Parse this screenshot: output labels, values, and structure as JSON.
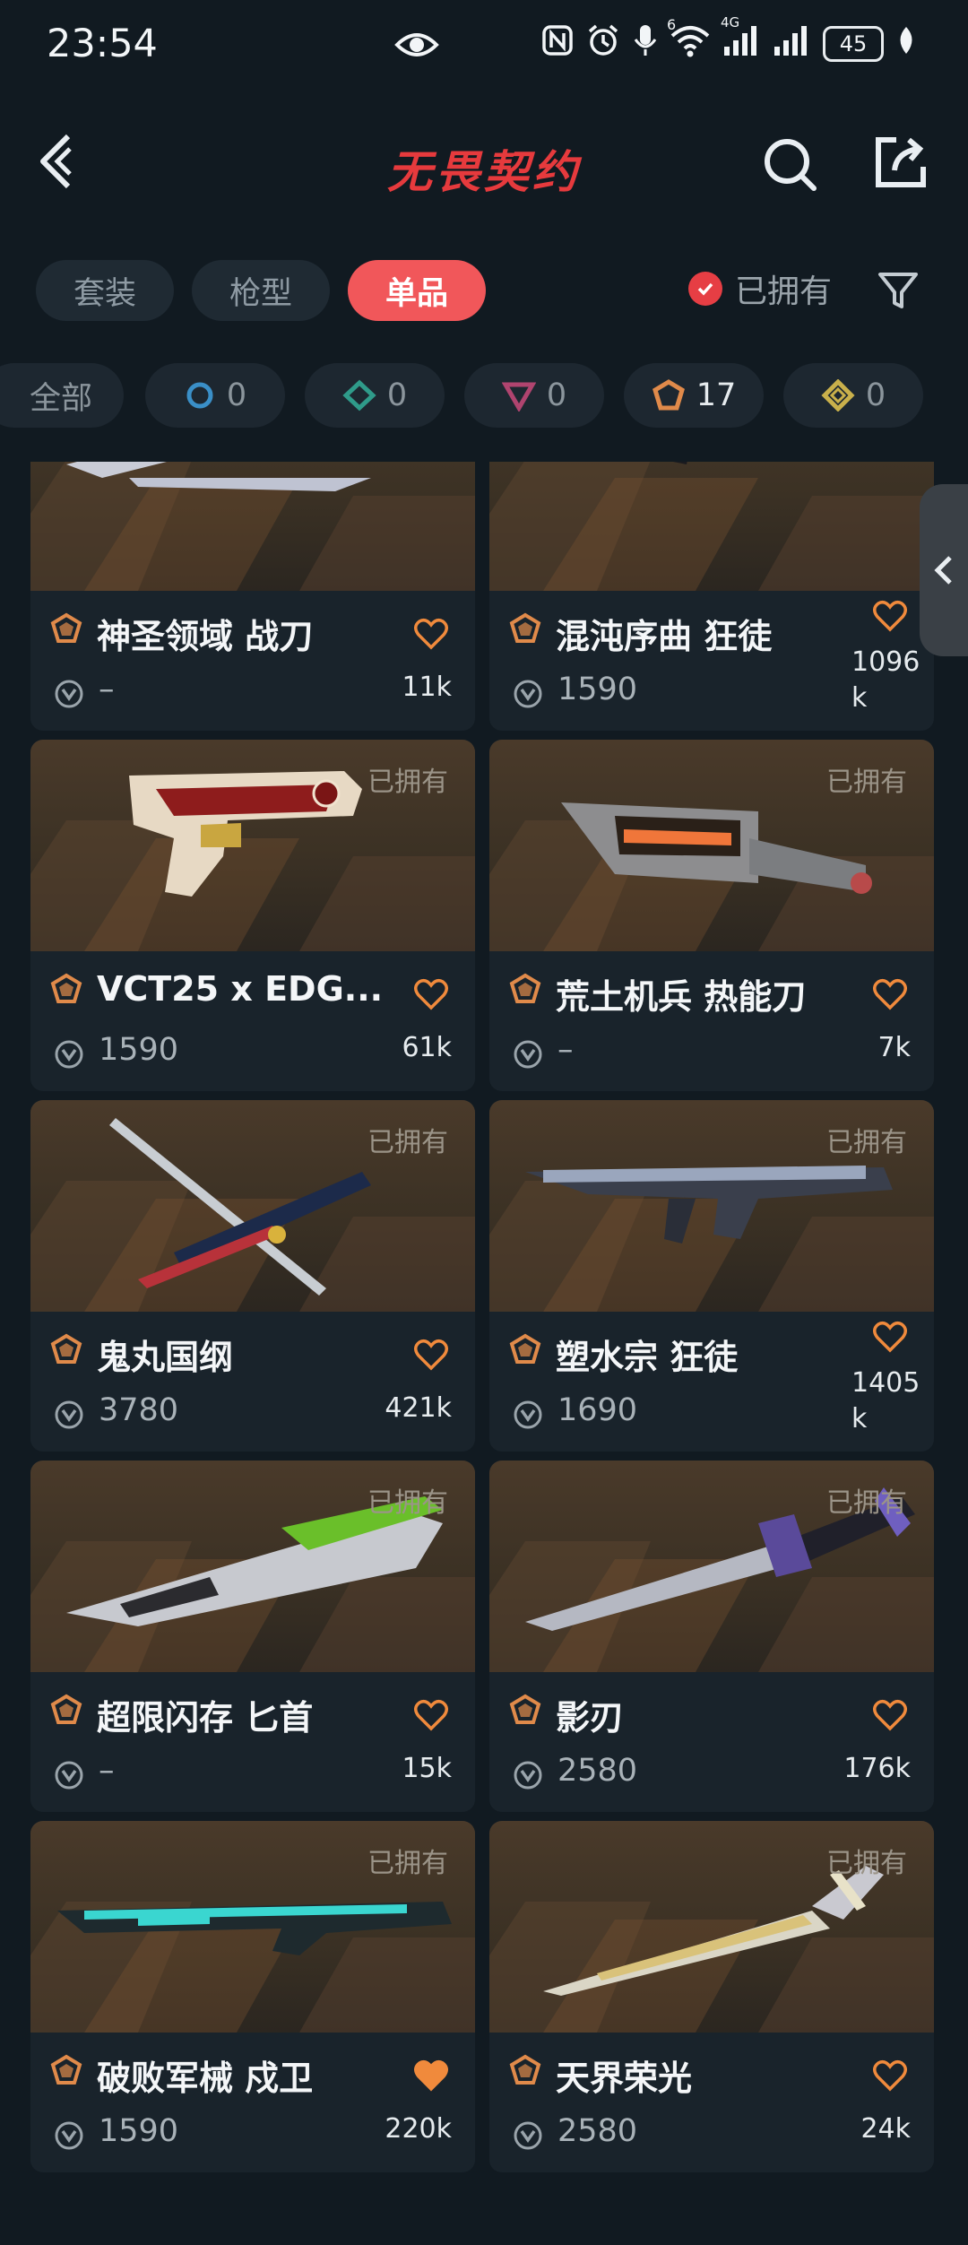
{
  "status_bar": {
    "time": "23:54",
    "signal_label": "4G",
    "wifi_label": "6",
    "battery": "45"
  },
  "header": {
    "title": "无畏契约"
  },
  "category_tabs": [
    {
      "label": "套装",
      "active": false
    },
    {
      "label": "枪型",
      "active": false
    },
    {
      "label": "单品",
      "active": true
    }
  ],
  "owned_filter": {
    "label": "已拥有",
    "checked": true
  },
  "tiers": [
    {
      "label": "全部",
      "count": ""
    },
    {
      "icon": "select-tier-icon",
      "color": "#3a8fc7",
      "count": "0"
    },
    {
      "icon": "deluxe-tier-icon",
      "color": "#2f9b8a",
      "count": "0"
    },
    {
      "icon": "premium-tier-icon",
      "color": "#b0446f",
      "count": "0"
    },
    {
      "icon": "exclusive-tier-icon",
      "color": "#e08a4a",
      "count": "17"
    },
    {
      "icon": "ultra-tier-icon",
      "color": "#c9b04b",
      "count": "0"
    }
  ],
  "owned_tag": "已拥有",
  "items": [
    {
      "name": "神圣领域 战刀",
      "price": "–",
      "likes": "11k",
      "owned": false,
      "liked": false
    },
    {
      "name": "混沌序曲 狂徒",
      "price": "1590",
      "likes": "1096 k",
      "owned": false,
      "liked": false
    },
    {
      "name": "VCT25 x EDG...",
      "price": "1590",
      "likes": "61k",
      "owned": true,
      "liked": false
    },
    {
      "name": "荒土机兵 热能刀",
      "price": "–",
      "likes": "7k",
      "owned": true,
      "liked": false
    },
    {
      "name": "鬼丸国纲",
      "price": "3780",
      "likes": "421k",
      "owned": true,
      "liked": false
    },
    {
      "name": "塑水宗 狂徒",
      "price": "1690",
      "likes": "1405 k",
      "owned": true,
      "liked": false
    },
    {
      "name": "超限闪存 匕首",
      "price": "–",
      "likes": "15k",
      "owned": true,
      "liked": false
    },
    {
      "name": "影刃",
      "price": "2580",
      "likes": "176k",
      "owned": true,
      "liked": false
    },
    {
      "name": "破败军械 戍卫",
      "price": "1590",
      "likes": "220k",
      "owned": true,
      "liked": true
    },
    {
      "name": "天界荣光",
      "price": "2580",
      "likes": "24k",
      "owned": true,
      "liked": false
    }
  ],
  "colors": {
    "accent": "#f1575a",
    "background": "#111a21",
    "rarity": "#e08a4a",
    "heart": "#f08a3c"
  }
}
